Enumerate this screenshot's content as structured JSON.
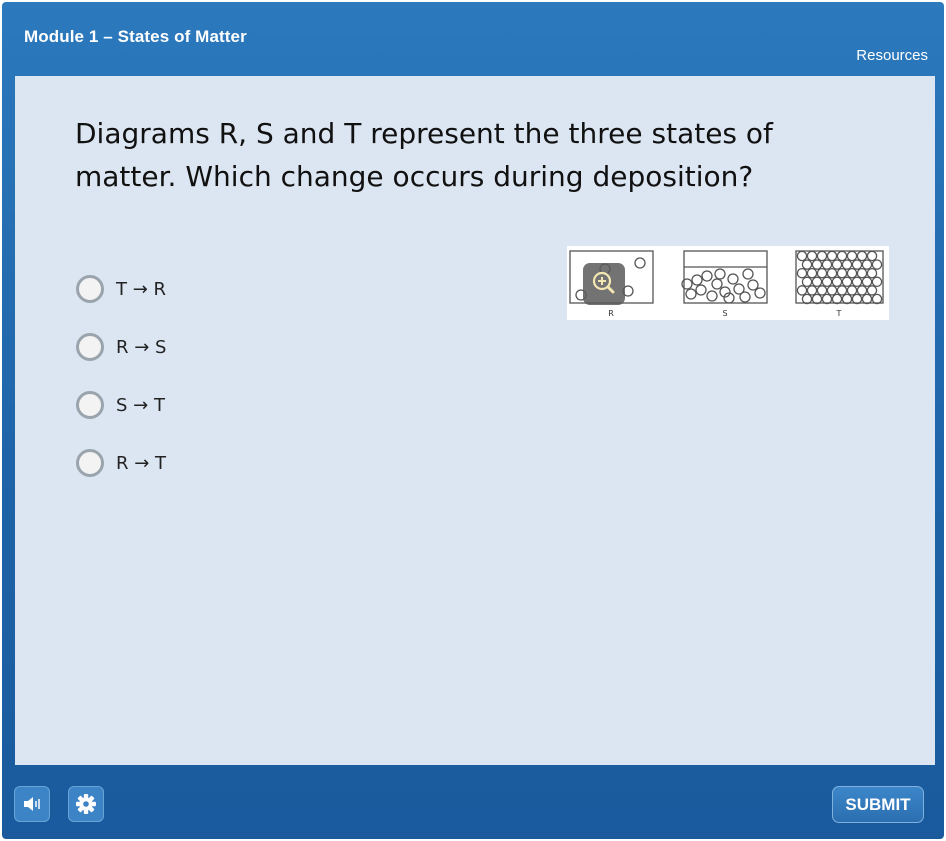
{
  "header": {
    "title": "Module 1 – States of Matter",
    "resources_label": "Resources"
  },
  "question": {
    "text": "Diagrams R, S and T represent the three states of matter. Which change occurs during deposition?"
  },
  "options": [
    {
      "label": "T → R",
      "selected": false
    },
    {
      "label": "R → S",
      "selected": false
    },
    {
      "label": "S → T",
      "selected": false
    },
    {
      "label": "R → T",
      "selected": false
    }
  ],
  "diagram": {
    "labels": [
      "R",
      "S",
      "T"
    ]
  },
  "icons": {
    "zoom": "zoom-in-icon",
    "audio": "speaker-icon",
    "settings": "gear-icon"
  },
  "footer": {
    "submit_label": "SUBMIT"
  },
  "colors": {
    "header_blue": "#2c79bd",
    "panel_bg": "#dce6f2",
    "button_blue": "#3d84c6"
  }
}
